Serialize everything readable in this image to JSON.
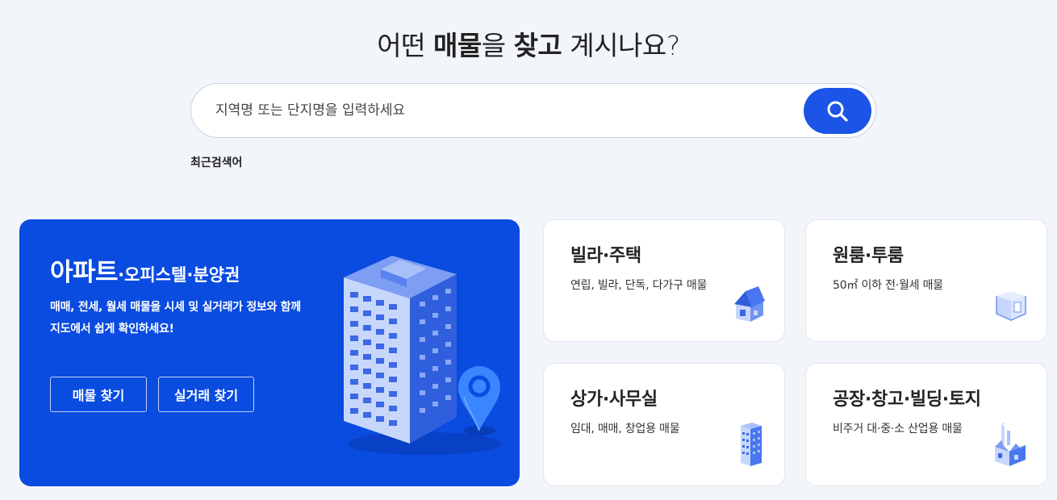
{
  "headline": {
    "part1": "어떤 ",
    "bold1": "매물",
    "part2": "을 ",
    "bold2": "찾고",
    "part3": " 계시나요?"
  },
  "search": {
    "placeholder": "지역명 또는 단지명을 입력하세요",
    "button_icon": "search-icon"
  },
  "recent_label": "최근검색어",
  "hero": {
    "title_main": "아파트",
    "separator": "·",
    "title_sub1": "오피스텔",
    "title_sub2": "분양권",
    "desc_line1": "매매, 전세, 월세 매물을 시세 및 실거래가 정보와 함께",
    "desc_line2": "지도에서 쉽게 확인하세요!",
    "btn_find": "매물 찾기",
    "btn_real": "실거래 찾기",
    "illustration": "apartment-building-with-location-pin-icon"
  },
  "cards": [
    {
      "title": "빌라·주택",
      "desc": "연립, 빌라, 단독, 다가구 매물",
      "icon": "house-icon"
    },
    {
      "title": "원룸·투룸",
      "desc": "50㎡ 이하 전·월세 매물",
      "icon": "room-icon"
    },
    {
      "title": "상가·사무실",
      "desc": "임대, 매매, 창업용 매물",
      "icon": "office-building-icon"
    },
    {
      "title": "공장·창고·빌딩·토지",
      "desc": "비주거 대·중·소 산업용 매물",
      "icon": "factory-icon"
    }
  ],
  "colors": {
    "background": "#f2f5f9",
    "primary_blue": "#0a4be0",
    "search_button": "#1b54e6",
    "icon_blue": "#4a76f0"
  }
}
